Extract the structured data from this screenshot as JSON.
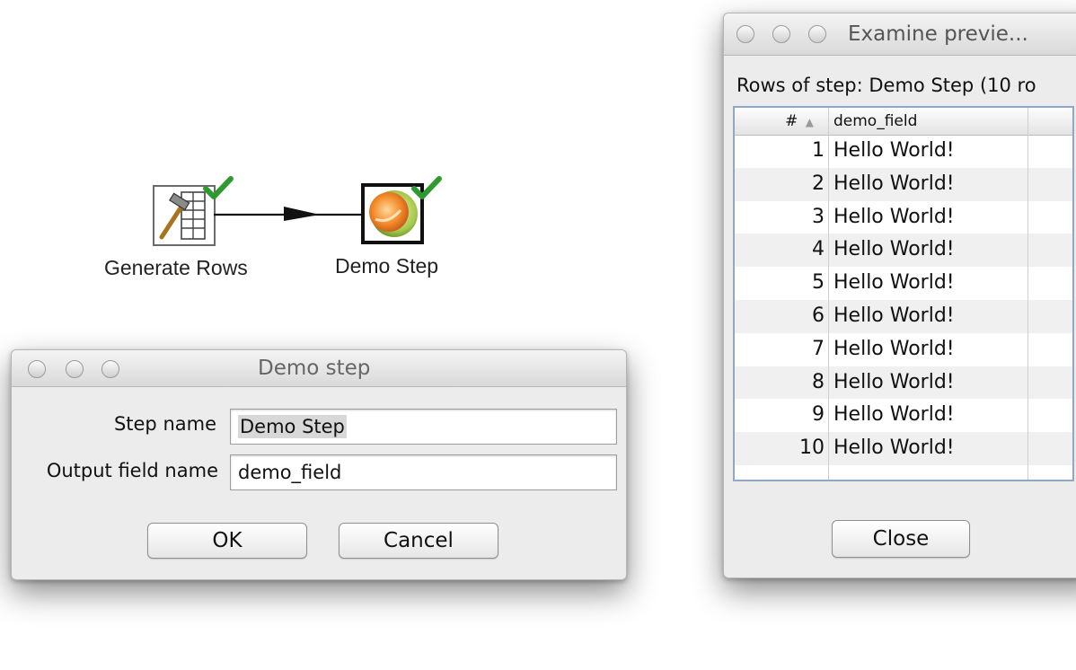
{
  "canvas": {
    "steps": [
      {
        "name": "Generate Rows",
        "icon": "generate-rows-icon",
        "status": "check-icon"
      },
      {
        "name": "Demo Step",
        "icon": "demo-step-icon",
        "status": "check-icon"
      }
    ],
    "hop": {
      "icon": "hop-arrow-icon"
    }
  },
  "demo_dialog": {
    "title": "Demo step",
    "step_name_label": "Step name",
    "step_name_value": "Demo Step",
    "output_field_label": "Output field name",
    "output_field_value": "demo_field",
    "ok_label": "OK",
    "cancel_label": "Cancel"
  },
  "preview_dialog": {
    "title": "Examine previe...",
    "caption": "Rows of step: Demo Step (10 ro",
    "columns": [
      "#",
      "demo_field"
    ],
    "sort_icon": "sort-ascending-icon",
    "rows": [
      {
        "num": "1",
        "value": "Hello World!"
      },
      {
        "num": "2",
        "value": "Hello World!"
      },
      {
        "num": "3",
        "value": "Hello World!"
      },
      {
        "num": "4",
        "value": "Hello World!"
      },
      {
        "num": "5",
        "value": "Hello World!"
      },
      {
        "num": "6",
        "value": "Hello World!"
      },
      {
        "num": "7",
        "value": "Hello World!"
      },
      {
        "num": "8",
        "value": "Hello World!"
      },
      {
        "num": "9",
        "value": "Hello World!"
      },
      {
        "num": "10",
        "value": "Hello World!"
      }
    ],
    "close_label": "Close"
  },
  "colors": {
    "check": "#2f9a2f",
    "table_border": "#8fa8c8",
    "row_alt": "#f0f0f0",
    "dialog_bg": "#ececec"
  }
}
